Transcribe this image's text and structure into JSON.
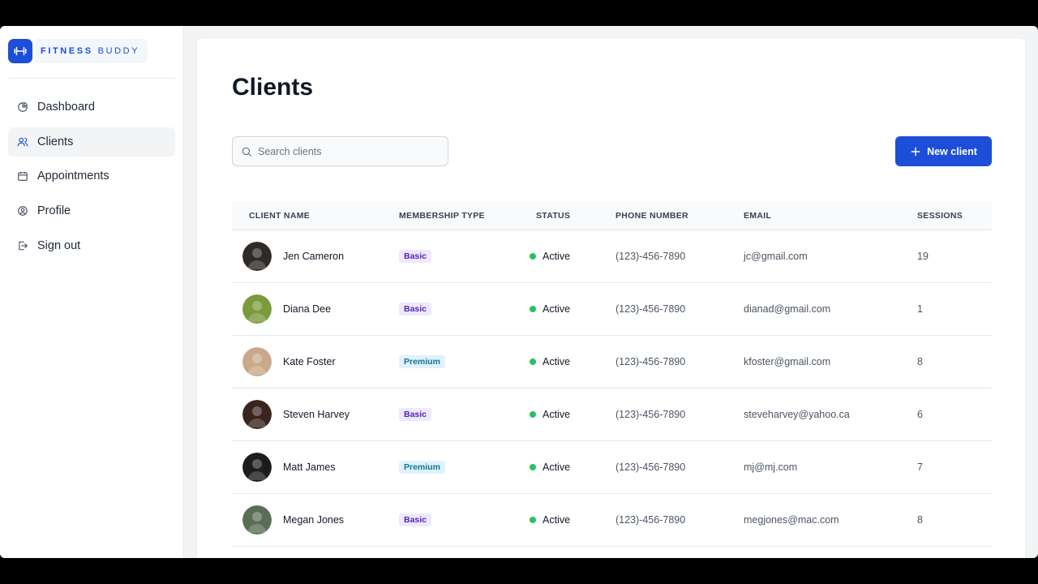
{
  "brand": {
    "part1": "FITNESS",
    "part2": "BUDDY",
    "accent": "#1d4ed8"
  },
  "nav": {
    "items": [
      {
        "label": "Dashboard",
        "icon": "pie-chart-icon"
      },
      {
        "label": "Clients",
        "icon": "users-icon",
        "active": true
      },
      {
        "label": "Appointments",
        "icon": "calendar-icon"
      },
      {
        "label": "Profile",
        "icon": "user-circle-icon"
      },
      {
        "label": "Sign out",
        "icon": "sign-out-icon"
      }
    ]
  },
  "page": {
    "title": "Clients"
  },
  "search": {
    "placeholder": "Search clients",
    "value": ""
  },
  "new_button": {
    "label": "New client"
  },
  "table": {
    "headers": {
      "name": "CLIENT NAME",
      "type": "MEMBERSHIP TYPE",
      "status": "STATUS",
      "phone": "PHONE NUMBER",
      "email": "EMAIL",
      "sessions": "SESSIONS"
    },
    "status_color": "#22c55e",
    "rows": [
      {
        "name": "Jen Cameron",
        "type": "Basic",
        "type_class": "basic",
        "status": "Active",
        "phone": "(123)-456-7890",
        "email": "jc@gmail.com",
        "sessions": "19",
        "avatar_color": "#2d2a28"
      },
      {
        "name": "Diana Dee",
        "type": "Basic",
        "type_class": "basic",
        "status": "Active",
        "phone": "(123)-456-7890",
        "email": "dianad@gmail.com",
        "sessions": "1",
        "avatar_color": "#7a9a3c"
      },
      {
        "name": "Kate Foster",
        "type": "Premium",
        "type_class": "premium",
        "status": "Active",
        "phone": "(123)-456-7890",
        "email": "kfoster@gmail.com",
        "sessions": "8",
        "avatar_color": "#c9a98a"
      },
      {
        "name": "Steven Harvey",
        "type": "Basic",
        "type_class": "basic",
        "status": "Active",
        "phone": "(123)-456-7890",
        "email": "steveharvey@yahoo.ca",
        "sessions": "6",
        "avatar_color": "#3a2420"
      },
      {
        "name": "Matt James",
        "type": "Premium",
        "type_class": "premium",
        "status": "Active",
        "phone": "(123)-456-7890",
        "email": "mj@mj.com",
        "sessions": "7",
        "avatar_color": "#1c1c1c"
      },
      {
        "name": "Megan Jones",
        "type": "Basic",
        "type_class": "basic",
        "status": "Active",
        "phone": "(123)-456-7890",
        "email": "megjones@mac.com",
        "sessions": "8",
        "avatar_color": "#5a6e55"
      }
    ]
  }
}
